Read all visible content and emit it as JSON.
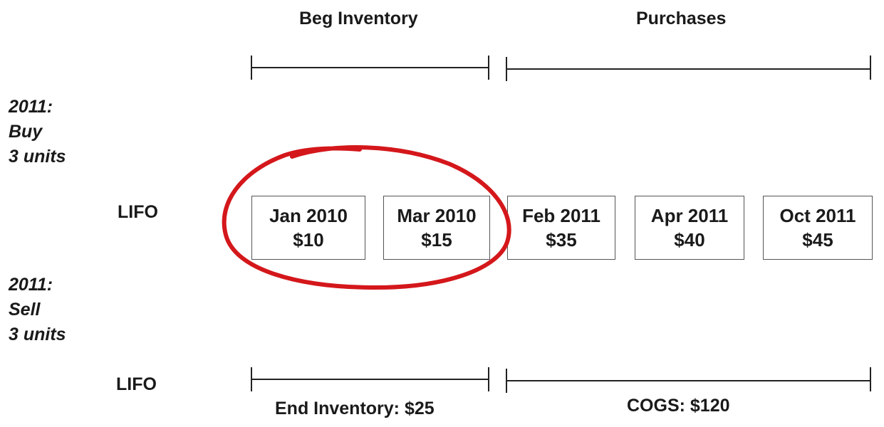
{
  "headers": {
    "beg_inventory": "Beg Inventory",
    "purchases": "Purchases"
  },
  "side_notes": {
    "buy": [
      "2011:",
      "Buy",
      "3 units"
    ],
    "sell": [
      "2011:",
      "Sell",
      "3 units"
    ]
  },
  "methods": {
    "top": "LIFO",
    "bottom": "LIFO"
  },
  "inventory_boxes": [
    {
      "date": "Jan 2010",
      "price": "$10"
    },
    {
      "date": "Mar 2010",
      "price": "$15"
    },
    {
      "date": "Feb 2011",
      "price": "$35"
    },
    {
      "date": "Apr 2011",
      "price": "$40"
    },
    {
      "date": "Oct 2011",
      "price": "$45"
    }
  ],
  "bottom_labels": {
    "end_inventory": "End Inventory: $25",
    "cogs": "COGS: $120"
  },
  "annotation": {
    "circle_color": "#d4171b"
  }
}
